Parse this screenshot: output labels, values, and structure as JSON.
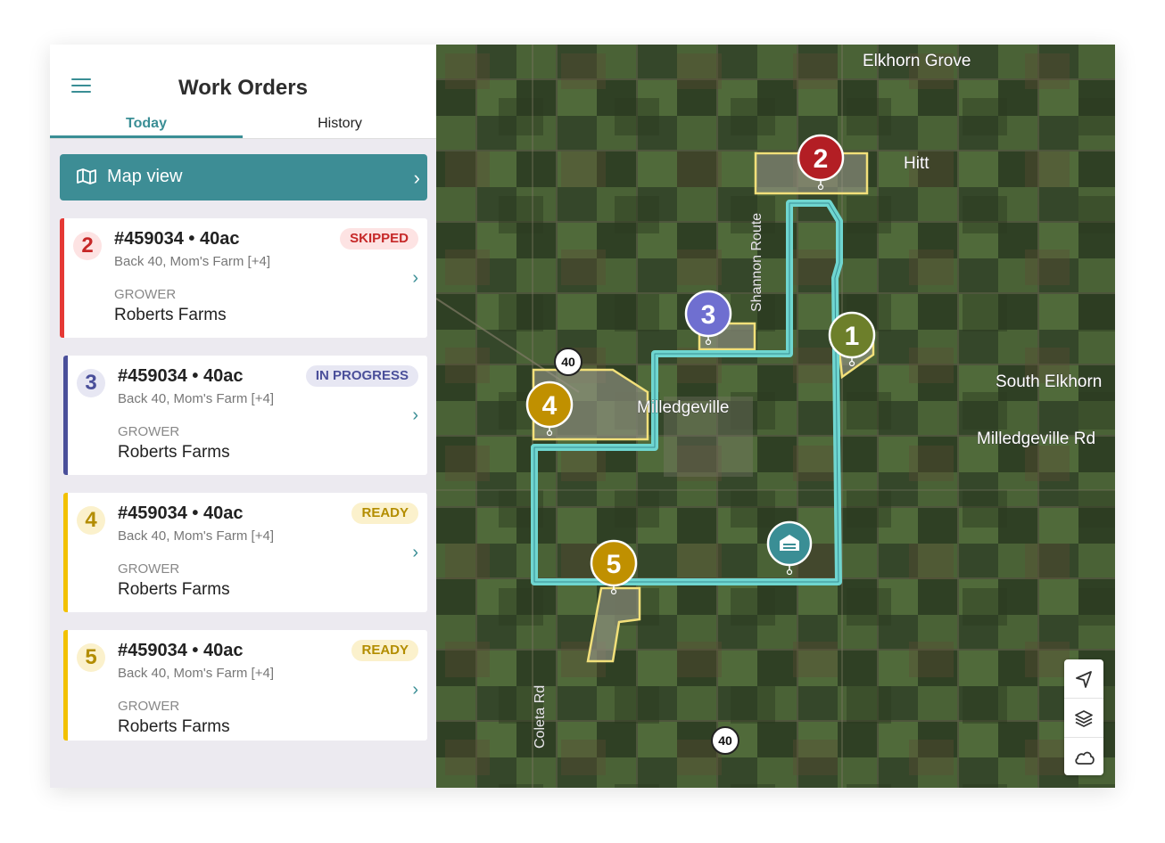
{
  "header": {
    "title": "Work Orders"
  },
  "tabs": [
    {
      "label": "Today"
    },
    {
      "label": "History"
    }
  ],
  "map_view": {
    "label": "Map view"
  },
  "orders": [
    {
      "num": "2",
      "order": "#459034 • 40ac",
      "location": "Back 40, Mom's Farm [+4]",
      "badge": "SKIPPED",
      "grower_label": "GROWER",
      "grower": "Roberts Farms"
    },
    {
      "num": "3",
      "order": "#459034 • 40ac",
      "location": "Back 40, Mom's Farm [+4]",
      "badge": "IN PROGRESS",
      "grower_label": "GROWER",
      "grower": "Roberts Farms"
    },
    {
      "num": "4",
      "order": "#459034 • 40ac",
      "location": "Back 40, Mom's Farm [+4]",
      "badge": "READY",
      "grower_label": "GROWER",
      "grower": "Roberts Farms"
    },
    {
      "num": "5",
      "order": "#459034 • 40ac",
      "location": "Back 40, Mom's Farm [+4]",
      "badge": "READY",
      "grower_label": "GROWER",
      "grower": "Roberts Farms"
    }
  ],
  "map": {
    "labels": {
      "elkhorn_grove": "Elkhorn Grove",
      "hitt": "Hitt",
      "south_elkhorn": "South Elkhorn",
      "milledgeville_rd": "Milledgeville Rd",
      "milledgeville": "Milledgeville",
      "shannon_route": "Shannon Route",
      "coleta_rd": "Coleta Rd",
      "route_40_a": "40",
      "route_40_b": "40"
    },
    "markers": {
      "m1": "1",
      "m2": "2",
      "m3": "3",
      "m4": "4",
      "m5": "5"
    }
  },
  "colors": {
    "accent": "#3a8e95",
    "skipped": "#e53935",
    "in_progress": "#4a4f9a",
    "ready": "#f2c100",
    "route": "#6fd6d0"
  },
  "icons": {
    "menu": "menu-icon",
    "map_view": "map-icon",
    "chevron": "chevron-right-icon",
    "location": "navigation-arrow-icon",
    "layers": "layers-icon",
    "weather": "cloud-icon",
    "barn": "barn-icon"
  }
}
